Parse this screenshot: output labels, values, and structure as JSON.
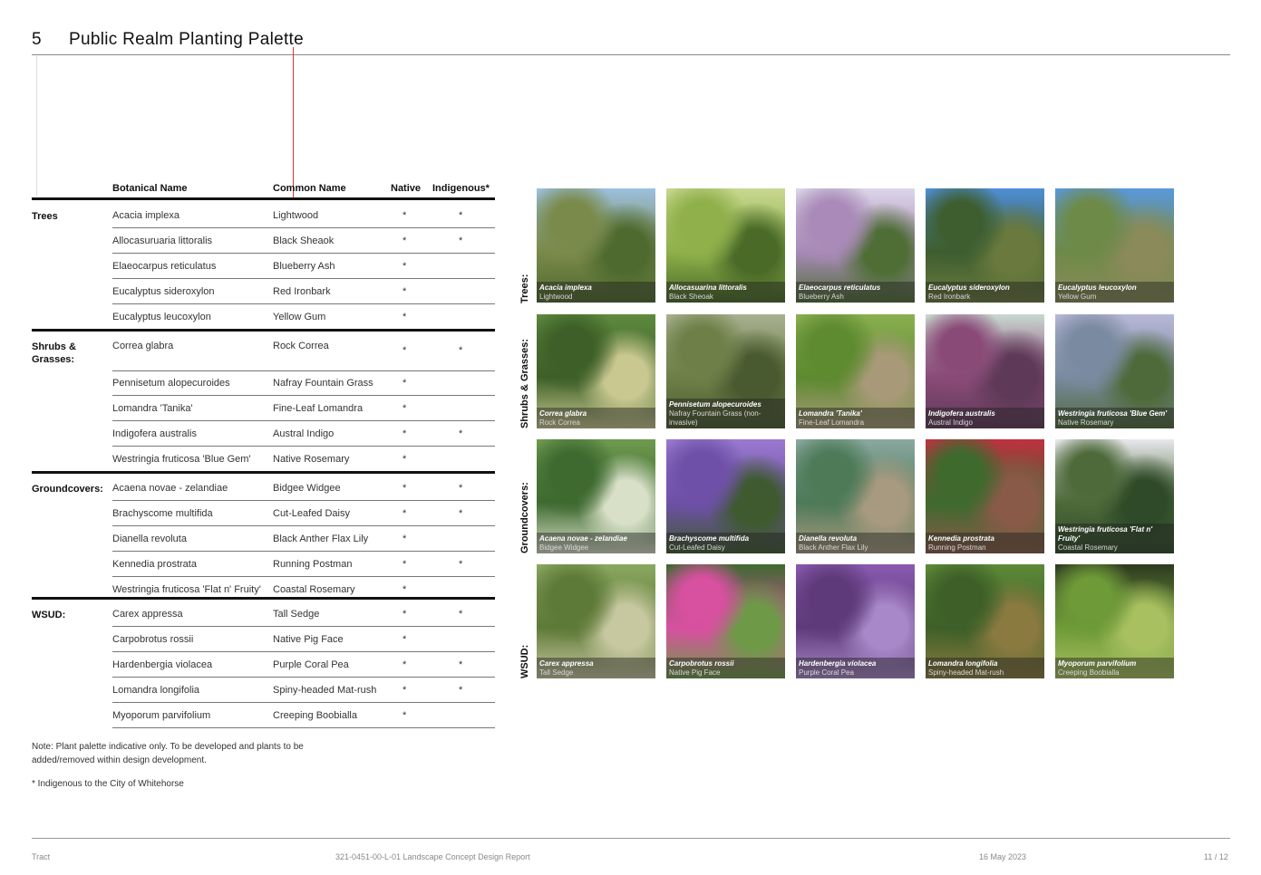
{
  "page": {
    "number": "5",
    "title": "Public Realm Planting Palette"
  },
  "table": {
    "headers": {
      "botanical": "Botanical Name",
      "common": "Common Name",
      "native": "Native",
      "indigenous": "Indigenous*"
    },
    "groups": [
      {
        "category": "Trees",
        "rows": [
          {
            "botanical": "Acacia implexa",
            "common": "Lightwood",
            "native": "*",
            "indigenous": "*"
          },
          {
            "botanical": "Allocasuruaria littoralis",
            "common": "Black Sheaok",
            "native": "*",
            "indigenous": "*"
          },
          {
            "botanical": "Elaeocarpus reticulatus",
            "common": "Blueberry Ash",
            "native": "*",
            "indigenous": ""
          },
          {
            "botanical": "Eucalyptus sideroxylon",
            "common": "Red Ironbark",
            "native": "*",
            "indigenous": ""
          },
          {
            "botanical": "Eucalyptus leucoxylon",
            "common": "Yellow Gum",
            "native": "*",
            "indigenous": ""
          }
        ]
      },
      {
        "category": "Shrubs & Grasses:",
        "rows": [
          {
            "botanical": "Correa glabra",
            "common": "Rock Correa",
            "native": "*",
            "indigenous": "*"
          },
          {
            "botanical": "Pennisetum alopecuroides",
            "common": "Nafray Fountain Grass",
            "native": "*",
            "indigenous": ""
          },
          {
            "botanical": "Lomandra 'Tanika'",
            "common": "Fine-Leaf Lomandra",
            "native": "*",
            "indigenous": ""
          },
          {
            "botanical": "Indigofera australis",
            "common": "Austral Indigo",
            "native": "*",
            "indigenous": "*"
          },
          {
            "botanical": "Westringia fruticosa 'Blue Gem'",
            "common": "Native Rosemary",
            "native": "*",
            "indigenous": ""
          }
        ]
      },
      {
        "category": "Groundcovers:",
        "rows": [
          {
            "botanical": "Acaena novae - zelandiae",
            "common": "Bidgee Widgee",
            "native": "*",
            "indigenous": "*"
          },
          {
            "botanical": "Brachyscome multifida",
            "common": "Cut-Leafed Daisy",
            "native": "*",
            "indigenous": "*"
          },
          {
            "botanical": "Dianella revoluta",
            "common": "Black Anther Flax Lily",
            "native": "*",
            "indigenous": ""
          },
          {
            "botanical": "Kennedia prostrata",
            "common": "Running Postman",
            "native": "*",
            "indigenous": "*"
          },
          {
            "botanical": "Westringia fruticosa 'Flat n' Fruity'",
            "common": "Coastal Rosemary",
            "native": "*",
            "indigenous": ""
          }
        ]
      },
      {
        "category": "WSUD:",
        "rows": [
          {
            "botanical": "Carex appressa",
            "common": "Tall Sedge",
            "native": "*",
            "indigenous": "*"
          },
          {
            "botanical": "Carpobrotus rossii",
            "common": "Native Pig Face",
            "native": "*",
            "indigenous": ""
          },
          {
            "botanical": "Hardenbergia violacea",
            "common": "Purple Coral Pea",
            "native": "*",
            "indigenous": "*"
          },
          {
            "botanical": "Lomandra longifolia",
            "common": "Spiny-headed Mat-rush",
            "native": "*",
            "indigenous": "*"
          },
          {
            "botanical": "Myoporum parvifolium",
            "common": "Creeping Boobialla",
            "native": "*",
            "indigenous": ""
          }
        ]
      }
    ]
  },
  "notes": {
    "note": "Note: Plant palette indicative only. To be developed and plants to be added/removed within design development.",
    "indigenous": "* Indigenous to the City of Whitehorse"
  },
  "gallery": {
    "rows": [
      {
        "label": "Trees:",
        "tiles": [
          {
            "botanical": "Acacia implexa",
            "common": "Lightwood",
            "palette": [
              "#9cc0e0",
              "#7a8a4a",
              "#4f6a2f"
            ]
          },
          {
            "botanical": "Allocasuarina littoralis",
            "common": "Black Sheoak",
            "palette": [
              "#c8d890",
              "#8fb04a",
              "#4a6a28"
            ]
          },
          {
            "botanical": "Elaeocarpus reticulatus",
            "common": "Blueberry Ash",
            "palette": [
              "#dcd6e8",
              "#a98ab8",
              "#4f6e36"
            ]
          },
          {
            "botanical": "Eucalyptus sideroxylon",
            "common": "Red Ironbark",
            "palette": [
              "#4f8fd8",
              "#3e5e30",
              "#6a7a3e"
            ]
          },
          {
            "botanical": "Eucalyptus leucoxylon",
            "common": "Yellow Gum",
            "palette": [
              "#5a98dc",
              "#6e8a48",
              "#8a8a5a"
            ]
          }
        ]
      },
      {
        "label": "Shrubs & Grasses:",
        "tiles": [
          {
            "botanical": "Correa glabra",
            "common": "Rock Correa",
            "palette": [
              "#5e8a3e",
              "#3e6028",
              "#c8c890"
            ]
          },
          {
            "botanical": "Pennisetum alopecuroides",
            "common": "Nafray Fountain Grass (non-invasive)",
            "palette": [
              "#a8b090",
              "#6e8048",
              "#4a5a30"
            ]
          },
          {
            "botanical": "Lomandra 'Tanika'",
            "common": "Fine-Leaf Lomandra",
            "palette": [
              "#8ab050",
              "#5e8a30",
              "#a89a78"
            ]
          },
          {
            "botanical": "Indigofera australis",
            "common": "Austral Indigo",
            "palette": [
              "#c8d8d0",
              "#8a4a78",
              "#5e3a58"
            ]
          },
          {
            "botanical": "Westringia fruticosa 'Blue Gem'",
            "common": "Native Rosemary",
            "palette": [
              "#b8b8d8",
              "#7a8aa0",
              "#4e6a3a"
            ]
          }
        ]
      },
      {
        "label": "Groundcovers:",
        "tiles": [
          {
            "botanical": "Acaena novae - zelandiae",
            "common": "Bidgee Widgee",
            "palette": [
              "#6e9a50",
              "#3e6a30",
              "#d8e0c8"
            ]
          },
          {
            "botanical": "Brachyscome multifida",
            "common": "Cut-Leafed Daisy",
            "palette": [
              "#9a7ad0",
              "#6e50a8",
              "#3e5a2e"
            ]
          },
          {
            "botanical": "Dianella revoluta",
            "common": "Black Anther Flax Lily",
            "palette": [
              "#8aa8a0",
              "#4e7a58",
              "#a89a80"
            ]
          },
          {
            "botanical": "Kennedia prostrata",
            "common": "Running Postman",
            "palette": [
              "#c03040",
              "#3e6a2e",
              "#8a5a48"
            ]
          },
          {
            "botanical": "Westringia fruticosa 'Flat n' Fruity'",
            "common": "Coastal Rosemary",
            "palette": [
              "#e8e8ec",
              "#4e6a3a",
              "#2e4a28"
            ]
          }
        ]
      },
      {
        "label": "WSUD:",
        "tiles": [
          {
            "botanical": "Carex appressa",
            "common": "Tall Sedge",
            "palette": [
              "#8aa860",
              "#5e7a38",
              "#c8c8a0"
            ]
          },
          {
            "botanical": "Carpobrotus rossii",
            "common": "Native Pig Face",
            "palette": [
              "#3e6a30",
              "#d850a0",
              "#6e9a48"
            ]
          },
          {
            "botanical": "Hardenbergia violacea",
            "common": "Purple Coral Pea",
            "palette": [
              "#8a5ab0",
              "#5e3a7a",
              "#a888c8"
            ]
          },
          {
            "botanical": "Lomandra longifolia",
            "common": "Spiny-headed Mat-rush",
            "palette": [
              "#5e8a38",
              "#3e6028",
              "#8a7a40"
            ]
          },
          {
            "botanical": "Myoporum parvifolium",
            "common": "Creeping Boobialla",
            "palette": [
              "#2e3a20",
              "#6e9a38",
              "#a8c060"
            ]
          }
        ]
      }
    ]
  },
  "footer": {
    "left": "Tract",
    "center": "321-0451-00-L-01 Landscape Concept Design Report",
    "date": "16 May 2023",
    "page": "11 / 12"
  }
}
